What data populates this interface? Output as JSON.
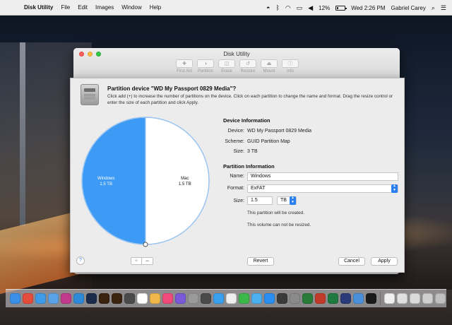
{
  "menubar": {
    "app_name": "Disk Utility",
    "menus": [
      "File",
      "Edit",
      "Images",
      "Window",
      "Help"
    ],
    "battery": "12%",
    "datetime": "Wed 2:26 PM",
    "user": "Gabriel Carey"
  },
  "window": {
    "title": "Disk Utility",
    "toolbar": [
      {
        "label": "First Aid",
        "icon": "stethoscope-icon"
      },
      {
        "label": "Partition",
        "icon": "partition-icon"
      },
      {
        "label": "Erase",
        "icon": "erase-icon"
      },
      {
        "label": "Restore",
        "icon": "restore-icon"
      },
      {
        "label": "Mount",
        "icon": "mount-icon"
      },
      {
        "label": "Info",
        "icon": "info-icon"
      }
    ]
  },
  "sheet": {
    "title": "Partition device \"WD My Passport 0829 Media\"?",
    "description": "Click add (+) to increase the number of partitions on the device. Click on each partition to change the name and format. Drag the resize control or enter the size of each partition and click Apply.",
    "device_info": {
      "heading": "Device Information",
      "device_label": "Device:",
      "device_value": "WD My Passport 0829 Media",
      "scheme_label": "Scheme:",
      "scheme_value": "GUID Partition Map",
      "size_label": "Size:",
      "size_value": "3 TB"
    },
    "partition_info": {
      "heading": "Partition Information",
      "name_label": "Name:",
      "name_value": "Windows",
      "format_label": "Format:",
      "format_value": "ExFAT",
      "size_label": "Size:",
      "size_value": "1.5",
      "size_unit": "TB",
      "note_created": "This partition will be created.",
      "note_resize": "This volume can not be resized."
    },
    "buttons": {
      "help": "?",
      "add": "+",
      "remove": "−",
      "revert": "Revert",
      "cancel": "Cancel",
      "apply": "Apply"
    }
  },
  "chart_data": {
    "type": "pie",
    "slices": [
      {
        "name": "Windows",
        "size_label": "1.5 TB",
        "value": 1.5,
        "color": "#3d9af5",
        "selected": true
      },
      {
        "name": "Mac",
        "size_label": "1.5 TB",
        "value": 1.5,
        "color": "#ffffff",
        "selected": false
      }
    ]
  },
  "colors": {
    "accent": "#2a7ff3",
    "selected_slice": "#3d9af5"
  },
  "dock": {
    "icons": [
      {
        "name": "finder-icon",
        "color": "#3b8fe8"
      },
      {
        "name": "chrome-icon",
        "color": "#e44c3c"
      },
      {
        "name": "safari-icon",
        "color": "#3f9be8"
      },
      {
        "name": "mail-icon",
        "color": "#5aa3e8"
      },
      {
        "name": "app-icon",
        "color": "#c23a8c"
      },
      {
        "name": "app-icon",
        "color": "#2e8ad8"
      },
      {
        "name": "photoshop-icon",
        "color": "#1b2c4a"
      },
      {
        "name": "illustrator-icon",
        "color": "#3a2210"
      },
      {
        "name": "bridge-icon",
        "color": "#3b2410"
      },
      {
        "name": "app-icon",
        "color": "#4a4a4a"
      },
      {
        "name": "calendar-icon",
        "color": "#ffffff"
      },
      {
        "name": "photos-icon",
        "color": "#f0b84a"
      },
      {
        "name": "music-icon",
        "color": "#f04a7a"
      },
      {
        "name": "app-icon",
        "color": "#7a5ad8"
      },
      {
        "name": "app-icon",
        "color": "#9a9a9a"
      },
      {
        "name": "app-icon",
        "color": "#4a4a4a"
      },
      {
        "name": "twitter-icon",
        "color": "#3aa0f0"
      },
      {
        "name": "calendar-icon",
        "color": "#eeeeee"
      },
      {
        "name": "app-icon",
        "color": "#3bb84a"
      },
      {
        "name": "app-icon",
        "color": "#4ab0f0"
      },
      {
        "name": "app-store-icon",
        "color": "#2a8ef0"
      },
      {
        "name": "app-icon",
        "color": "#3a3a3a"
      },
      {
        "name": "system-preferences-icon",
        "color": "#8a8a8a"
      },
      {
        "name": "app-icon",
        "color": "#2a7a3a"
      },
      {
        "name": "filezilla-icon",
        "color": "#c23a2a"
      },
      {
        "name": "excel-icon",
        "color": "#1e7a3e"
      },
      {
        "name": "app-icon",
        "color": "#2a3a7a"
      },
      {
        "name": "app-icon",
        "color": "#4a90d8"
      },
      {
        "name": "app-icon",
        "color": "#1a1a1a"
      },
      {
        "name": "app-icon",
        "color": "#f0f0f0"
      },
      {
        "name": "app-icon",
        "color": "#e0e0e0"
      },
      {
        "name": "app-icon",
        "color": "#dadada"
      },
      {
        "name": "app-icon",
        "color": "#cfcfcf"
      },
      {
        "name": "trash-icon",
        "color": "#c0c0c0"
      }
    ]
  }
}
